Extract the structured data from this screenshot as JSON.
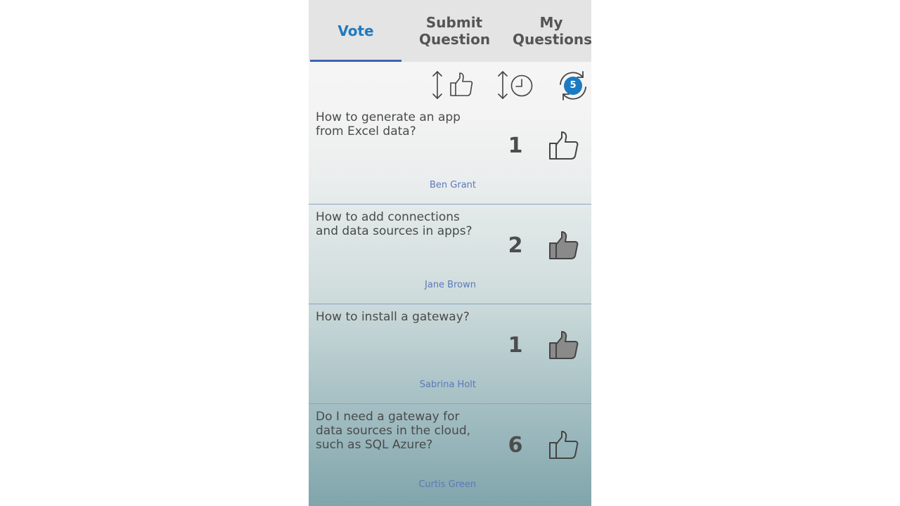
{
  "tabs": [
    {
      "label": "Vote",
      "active": true
    },
    {
      "label": "Submit Question",
      "active": false
    },
    {
      "label": "My Questions",
      "active": false
    }
  ],
  "toolbar": {
    "sort_by_votes_icon": "sort-thumbs-up-icon",
    "sort_by_time_icon": "sort-clock-icon",
    "refresh_icon": "refresh-icon",
    "refresh_badge": "5"
  },
  "questions": [
    {
      "text": "How to generate an app from Excel data?",
      "author": "Ben Grant",
      "votes": "1",
      "liked": false
    },
    {
      "text": "How to add connections and data sources in apps?",
      "author": "Jane Brown",
      "votes": "2",
      "liked": true
    },
    {
      "text": "How to install a gateway?",
      "author": "Sabrina Holt",
      "votes": "1",
      "liked": true
    },
    {
      "text": "Do I need a gateway for data sources in the cloud, such as SQL Azure?",
      "author": "Curtis Green",
      "votes": "6",
      "liked": false
    }
  ],
  "colors": {
    "accent": "#1f7ac0",
    "underline": "#3d63b4",
    "author": "#5b78ba",
    "badge": "#1a7bc2"
  }
}
